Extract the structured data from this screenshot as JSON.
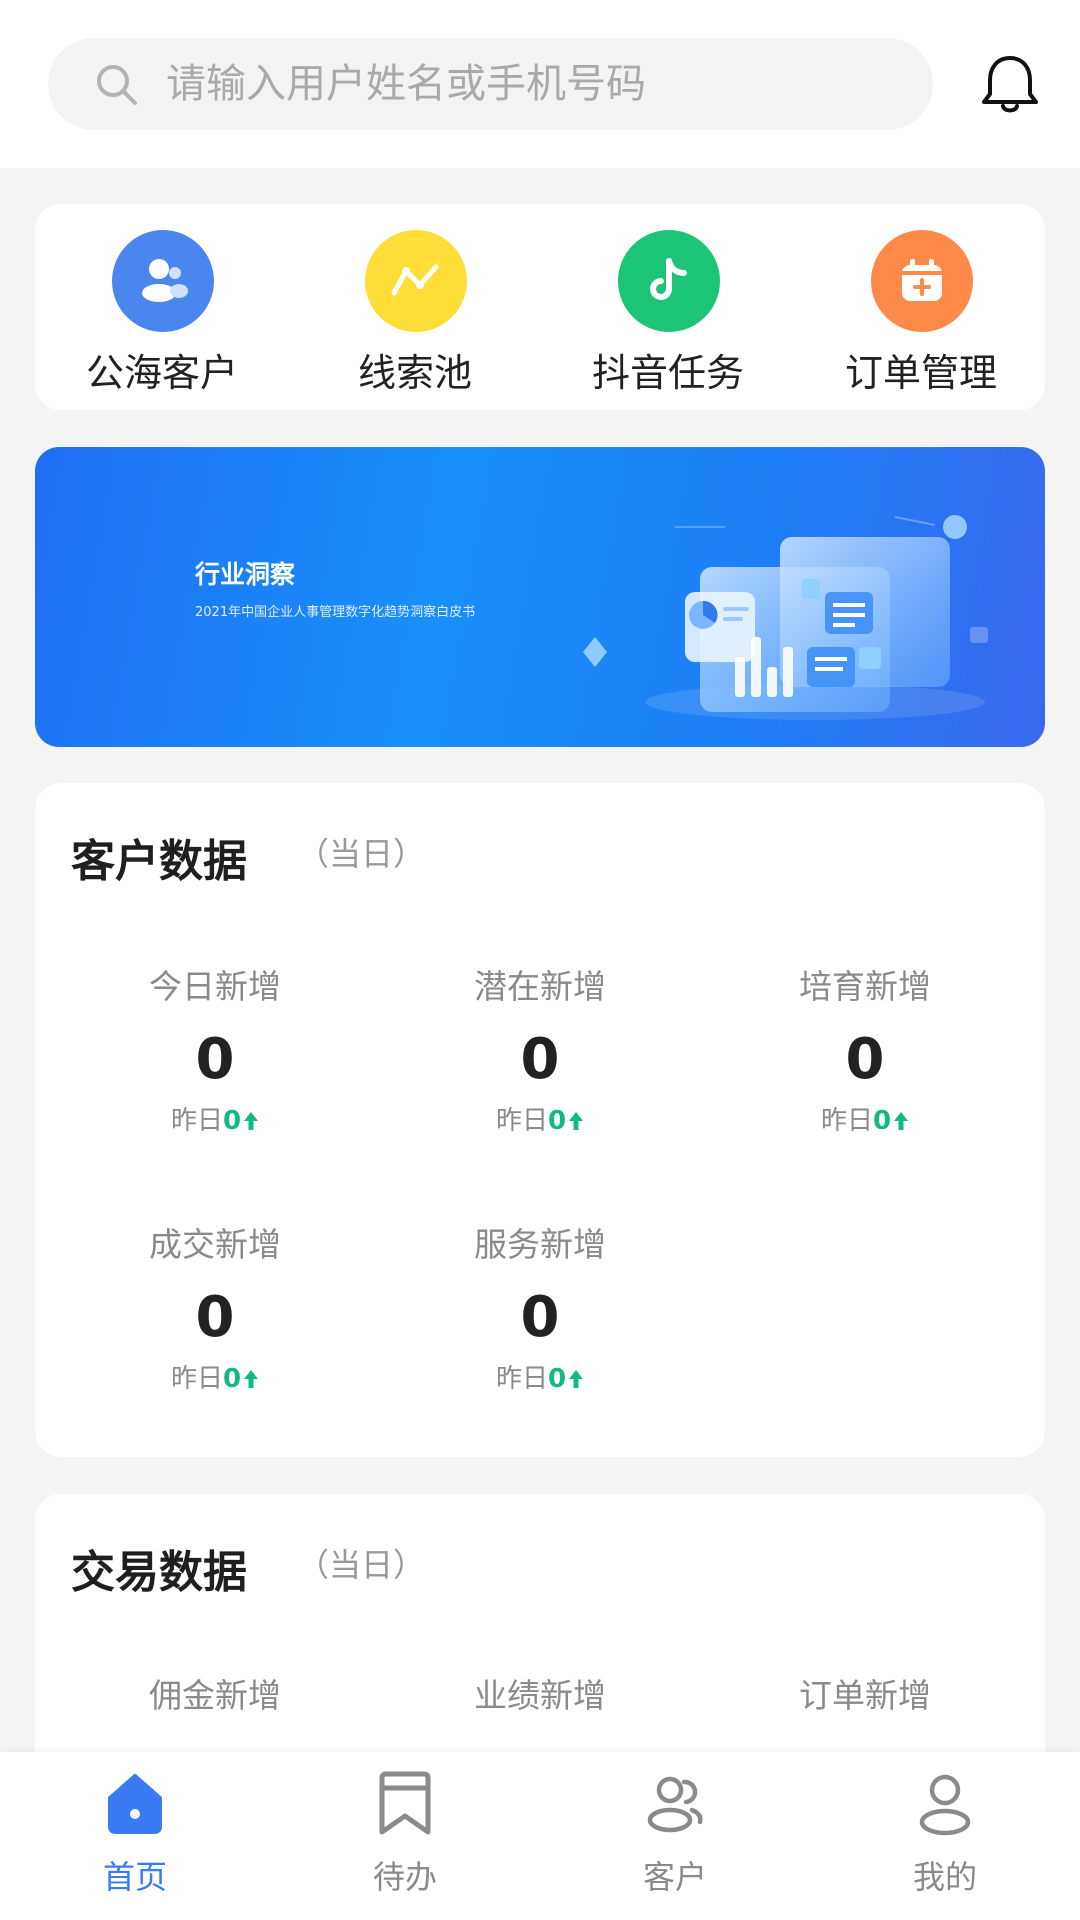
{
  "search": {
    "placeholder": "请输入用户姓名或手机号码"
  },
  "quick_actions": [
    {
      "label": "公海客户",
      "icon": "customers-icon",
      "color": "#4a86ee"
    },
    {
      "label": "线索池",
      "icon": "trend-line-icon",
      "color": "#ffde3a"
    },
    {
      "label": "抖音任务",
      "icon": "tiktok-icon",
      "color": "#1cc477"
    },
    {
      "label": "订单管理",
      "icon": "calendar-add-icon",
      "color": "#fd8a49"
    }
  ],
  "banner": {
    "title": "行业洞察",
    "subtitle": "2021年中国企业人事管理数字化趋势洞察白皮书"
  },
  "customer_data": {
    "title": "客户数据",
    "note": "（当日）",
    "yesterday_label": "昨日",
    "stats": [
      {
        "label": "今日新增",
        "value": "0",
        "yesterday": "0"
      },
      {
        "label": "潜在新增",
        "value": "0",
        "yesterday": "0"
      },
      {
        "label": "培育新增",
        "value": "0",
        "yesterday": "0"
      },
      {
        "label": "成交新增",
        "value": "0",
        "yesterday": "0"
      },
      {
        "label": "服务新增",
        "value": "0",
        "yesterday": "0"
      }
    ]
  },
  "trade_data": {
    "title": "交易数据",
    "note": "（当日）",
    "stats": [
      {
        "label": "佣金新增"
      },
      {
        "label": "业绩新增"
      },
      {
        "label": "订单新增"
      }
    ]
  },
  "tabbar": {
    "active": 0,
    "items": [
      {
        "label": "首页",
        "icon": "home-icon"
      },
      {
        "label": "待办",
        "icon": "bookmark-icon"
      },
      {
        "label": "客户",
        "icon": "users-icon"
      },
      {
        "label": "我的",
        "icon": "user-icon"
      }
    ]
  },
  "colors": {
    "accent": "#3a7bf5",
    "up": "#12b886"
  }
}
